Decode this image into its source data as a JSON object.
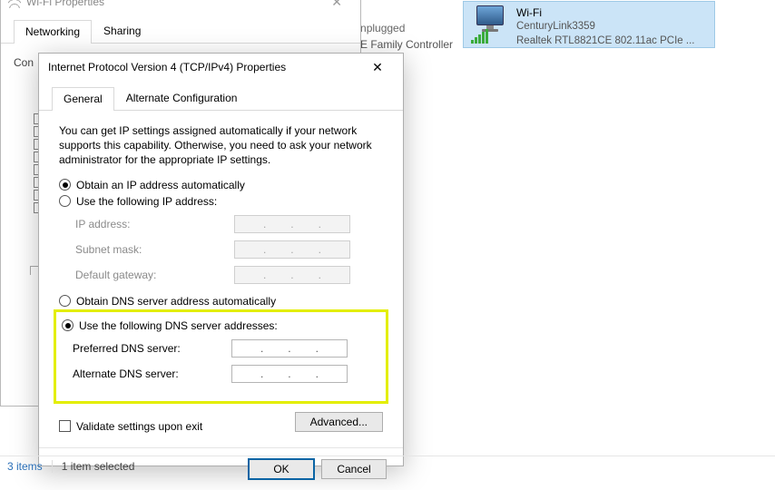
{
  "parent_window": {
    "title": "Wi-Fi Properties",
    "tabs": {
      "networking": "Networking",
      "sharing": "Sharing"
    },
    "connect_using_partial": "Con"
  },
  "background": {
    "line1": "ble unplugged",
    "line2": "e GbE Family Controller"
  },
  "net_card": {
    "name": "Wi-Fi",
    "ssid": "CenturyLink3359",
    "adapter": "Realtek RTL8821CE 802.11ac PCIe ..."
  },
  "dialog": {
    "title": "Internet Protocol Version 4 (TCP/IPv4) Properties",
    "tabs": {
      "general": "General",
      "alt": "Alternate Configuration"
    },
    "description": "You can get IP settings assigned automatically if your network supports this capability. Otherwise, you need to ask your network administrator for the appropriate IP settings.",
    "radio_ip_auto": "Obtain an IP address automatically",
    "radio_ip_manual": "Use the following IP address:",
    "labels_ip": {
      "ip": "IP address:",
      "mask": "Subnet mask:",
      "gw": "Default gateway:"
    },
    "radio_dns_auto": "Obtain DNS server address automatically",
    "radio_dns_manual": "Use the following DNS server addresses:",
    "labels_dns": {
      "pref": "Preferred DNS server:",
      "alt": "Alternate DNS server:"
    },
    "validate": "Validate settings upon exit",
    "advanced": "Advanced...",
    "ok": "OK",
    "cancel": "Cancel"
  },
  "statusbar": {
    "items": "3 items",
    "selected": "1 item selected"
  }
}
